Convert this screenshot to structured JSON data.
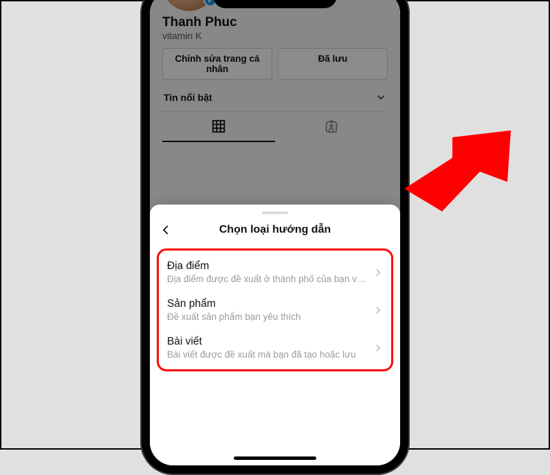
{
  "profile": {
    "name": "Thanh Phuc",
    "tagline": "vitamin K",
    "buttons": {
      "edit": "Chỉnh sửa trang cá nhân",
      "saved": "Đã lưu"
    },
    "highlights_label": "Tin nổi bật"
  },
  "sheet": {
    "title": "Chọn loại hướng dẫn",
    "options": [
      {
        "title": "Địa điểm",
        "subtitle": "Địa điểm được đề xuất ở thành phố của bạn và..."
      },
      {
        "title": "Sản phẩm",
        "subtitle": "Đề xuất sản phẩm bạn yêu thích"
      },
      {
        "title": "Bài viết",
        "subtitle": "Bài viết được đề xuất mà bạn đã tạo hoặc lưu"
      }
    ]
  }
}
